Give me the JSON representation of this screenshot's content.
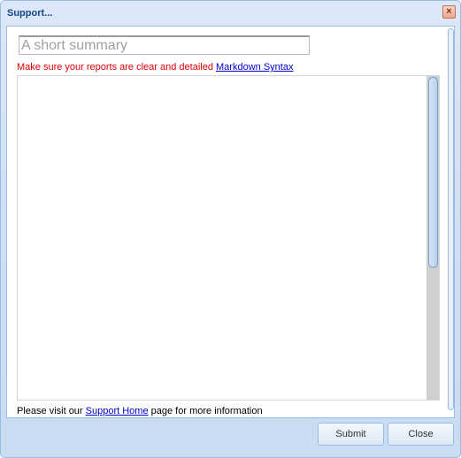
{
  "dialog": {
    "title": "Support...",
    "close_glyph": "×"
  },
  "form": {
    "summary_placeholder": "A short summary",
    "summary_value": "",
    "hint_text": "Make sure your reports are clear and detailed",
    "markdown_link": "Markdown Syntax",
    "details_value": "",
    "footer_prefix": "Please visit our",
    "support_home_link": "Support Home",
    "footer_suffix": "page for more information"
  },
  "buttons": {
    "submit": "Submit",
    "close": "Close"
  },
  "colors": {
    "title": "#15428b",
    "hint": "#dd0000",
    "link": "#0000cc",
    "border": "#99bbe8"
  }
}
